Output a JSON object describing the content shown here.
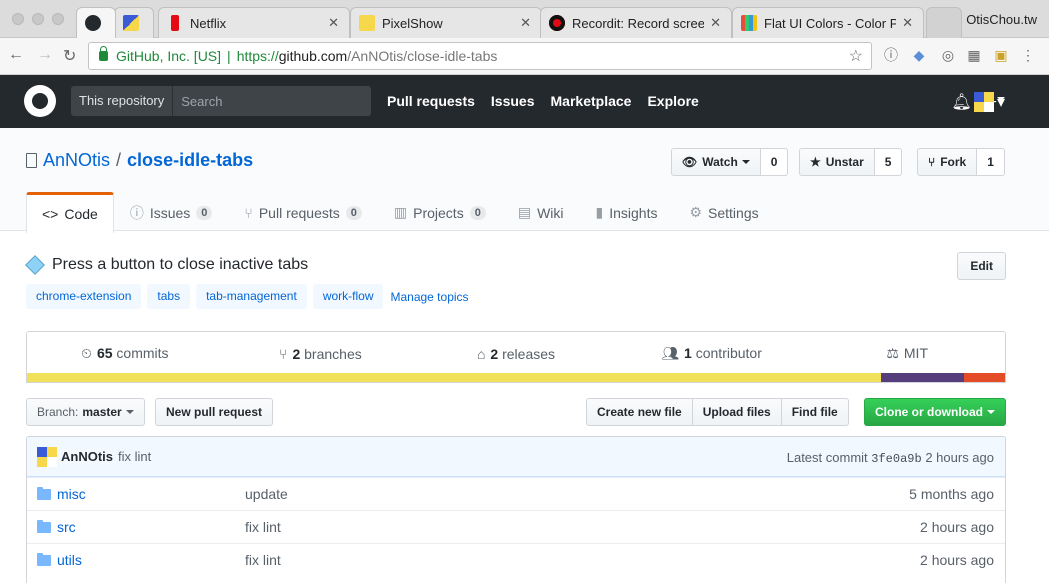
{
  "browser": {
    "tabs": [
      {
        "label": "",
        "favicon_color": "#24292e",
        "icon": "github-icon"
      },
      {
        "label": "",
        "favicon_color": "#3a5bd6",
        "icon": "pixel-avatar-icon"
      },
      {
        "label": "Netflix",
        "favicon_color": "#e50914",
        "icon": "netflix-icon"
      },
      {
        "label": "PixelShow",
        "favicon_color": "#f7d84a",
        "icon": "pixelshow-icon"
      },
      {
        "label": "Recordit: Record screen",
        "favicon_color": "#111111",
        "icon": "recordit-icon"
      },
      {
        "label": "Flat UI Colors - Color Pa",
        "favicon_color": "#e74c3c",
        "icon": "flatui-icon"
      }
    ],
    "user": "OtisChou.tw",
    "address": {
      "secure_label": "GitHub, Inc. [US]",
      "scheme": "https://",
      "host": "github.com",
      "path": "/AnNOtis/close-idle-tabs"
    }
  },
  "header": {
    "scope_label": "This repository",
    "search_placeholder": "Search",
    "nav": [
      "Pull requests",
      "Issues",
      "Marketplace",
      "Explore"
    ]
  },
  "repo": {
    "owner": "AnNOtis",
    "name": "close-idle-tabs",
    "watch_label": "Watch",
    "watch_count": "0",
    "unstar_label": "Unstar",
    "star_count": "5",
    "fork_label": "Fork",
    "fork_count": "1",
    "tabs": [
      {
        "label": "Code",
        "count": "",
        "icon": "<>"
      },
      {
        "label": "Issues",
        "count": "0",
        "icon": "ⓘ"
      },
      {
        "label": "Pull requests",
        "count": "0",
        "icon": "⑂"
      },
      {
        "label": "Projects",
        "count": "0",
        "icon": "▥"
      },
      {
        "label": "Wiki",
        "count": "",
        "icon": "▤"
      },
      {
        "label": "Insights",
        "count": "",
        "icon": "▮"
      },
      {
        "label": "Settings",
        "count": "",
        "icon": "⚙"
      }
    ],
    "description": "Press a button to close inactive tabs",
    "edit_label": "Edit",
    "topics": [
      "chrome-extension",
      "tabs",
      "tab-management",
      "work-flow"
    ],
    "manage_topics": "Manage topics"
  },
  "summary": {
    "commits_num": "65",
    "commits_label": "commits",
    "branches_num": "2",
    "branches_label": "branches",
    "releases_num": "2",
    "releases_label": "releases",
    "contributors_num": "1",
    "contributors_label": "contributor",
    "license": "MIT",
    "language_colors": [
      "#f1e05a",
      "#563d7c",
      "#e34c26"
    ],
    "language_fractions": [
      0.873,
      0.085,
      0.042
    ]
  },
  "filebar": {
    "branch_prefix": "Branch:",
    "branch": "master",
    "new_pr": "New pull request",
    "create_file": "Create new file",
    "upload": "Upload files",
    "find": "Find file",
    "clone": "Clone or download"
  },
  "commit": {
    "author": "AnNOtis",
    "message": "fix lint",
    "latest_label": "Latest commit",
    "sha": "3fe0a9b",
    "age": "2 hours ago"
  },
  "files": [
    {
      "name": "misc",
      "message": "update",
      "age": "5 months ago"
    },
    {
      "name": "src",
      "message": "fix lint",
      "age": "2 hours ago"
    },
    {
      "name": "utils",
      "message": "fix lint",
      "age": "2 hours ago"
    }
  ]
}
